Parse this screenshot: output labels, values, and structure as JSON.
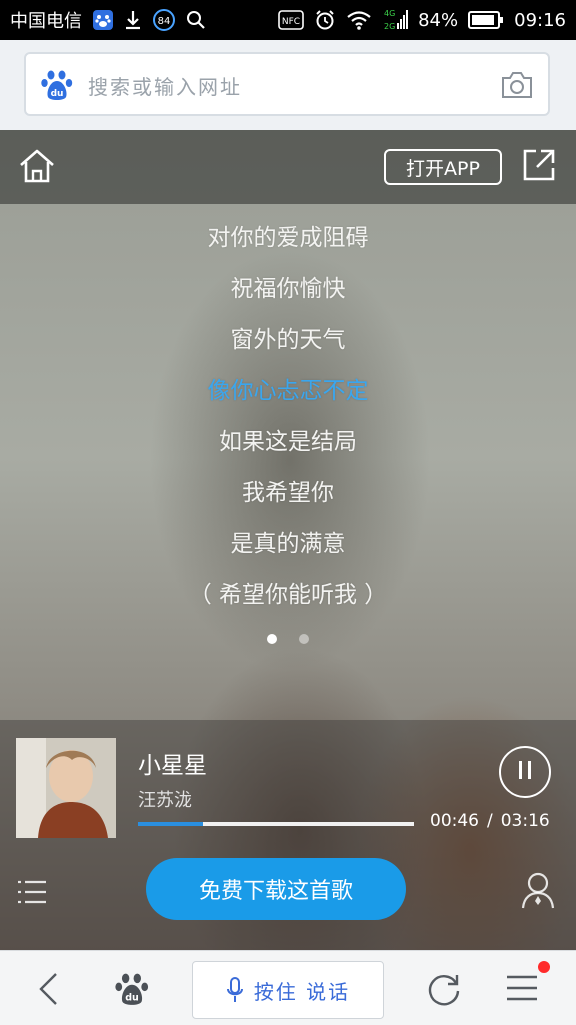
{
  "status_bar": {
    "carrier": "中国电信",
    "badge_number": "84",
    "nfc_label": "NFC",
    "network_4g": "4G",
    "network_2g": "2G",
    "battery_percent": "84%",
    "time": "09:16"
  },
  "search": {
    "placeholder": "搜索或输入网址"
  },
  "player_header": {
    "open_app_label": "打开APP"
  },
  "lyrics": [
    {
      "text": "对你的爱成阻碍",
      "active": false
    },
    {
      "text": "祝福你愉快",
      "active": false
    },
    {
      "text": "窗外的天气",
      "active": false
    },
    {
      "text": "像你心忐忑不定",
      "active": true
    },
    {
      "text": "如果这是结局",
      "active": false
    },
    {
      "text": "我希望你",
      "active": false
    },
    {
      "text": "是真的满意",
      "active": false
    },
    {
      "text": "（ 希望你能听我 ）",
      "active": false
    }
  ],
  "pager": {
    "count": 2,
    "active_index": 0
  },
  "song": {
    "title": "小星星",
    "artist": "汪苏泷",
    "current_time": "00:46",
    "separator": "/",
    "total_time": "03:16",
    "progress_fraction": 0.235
  },
  "download_button_label": "免费下载这首歌",
  "bottom_nav": {
    "voice_label": "按住 说话"
  },
  "colors": {
    "accent_blue": "#1a9be8",
    "active_lyric": "#3aa6ee",
    "notification_dot": "#ff2b2b"
  },
  "icons": [
    "baidu-paw-icon",
    "download-icon",
    "search-icon",
    "alarm-icon",
    "wifi-icon",
    "signal-icon",
    "battery-icon",
    "camera-icon",
    "home-icon",
    "share-icon",
    "pause-icon",
    "playlist-icon",
    "singer-icon",
    "back-icon",
    "mic-icon",
    "refresh-icon",
    "menu-icon"
  ]
}
